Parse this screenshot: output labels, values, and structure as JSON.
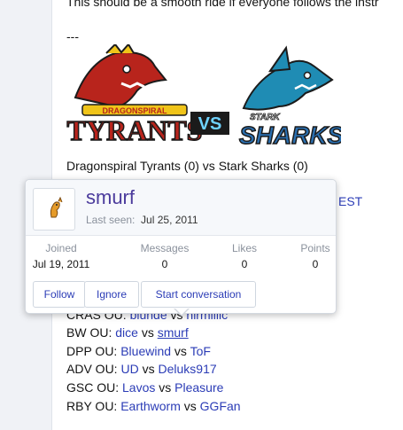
{
  "post": {
    "intro_line": "This should be a smooth ride if everyone follows the instr",
    "separator": "---",
    "team_left": {
      "top": "DRAGONSPIRAL",
      "bottom": "TYRANTS"
    },
    "vs_logo": "VS",
    "team_right": {
      "top": "STARK",
      "bottom": "SHARKS"
    },
    "matchup": "Dragonspiral Tyrants (0) vs Stark Sharks (0)",
    "est_fragment": "EST",
    "pairings": [
      {
        "tier": "CRAS OU:",
        "p1": "blunde",
        "vs": "vs",
        "p2": "nirmillic"
      },
      {
        "tier": "BW OU:",
        "p1": "dice",
        "vs": "vs",
        "p2": "smurf"
      },
      {
        "tier": "DPP OU:",
        "p1": "Bluewind",
        "vs": "vs",
        "p2": "ToF"
      },
      {
        "tier": "ADV OU:",
        "p1": "UD",
        "vs": "vs",
        "p2": "Deluks917"
      },
      {
        "tier": "GSC OU:",
        "p1": "Lavos",
        "vs": "vs",
        "p2": "Pleasure"
      },
      {
        "tier": "RBY OU:",
        "p1": "Earthworm",
        "vs": "vs",
        "p2": "GGFan"
      }
    ]
  },
  "member_card": {
    "username": "smurf",
    "last_seen_label": "Last seen:",
    "last_seen_value": "Jul 25, 2011",
    "stats": {
      "joined_label": "Joined",
      "joined_value": "Jul 19, 2011",
      "messages_label": "Messages",
      "messages_value": "0",
      "likes_label": "Likes",
      "likes_value": "0",
      "points_label": "Points",
      "points_value": "0"
    },
    "buttons": {
      "follow": "Follow",
      "ignore": "Ignore",
      "start": "Start conversation"
    }
  },
  "colors": {
    "link": "#2b3cb6",
    "username": "#4b3b9c",
    "tyrants_red": "#b8241c",
    "sharks_blue": "#2a6fb0"
  }
}
